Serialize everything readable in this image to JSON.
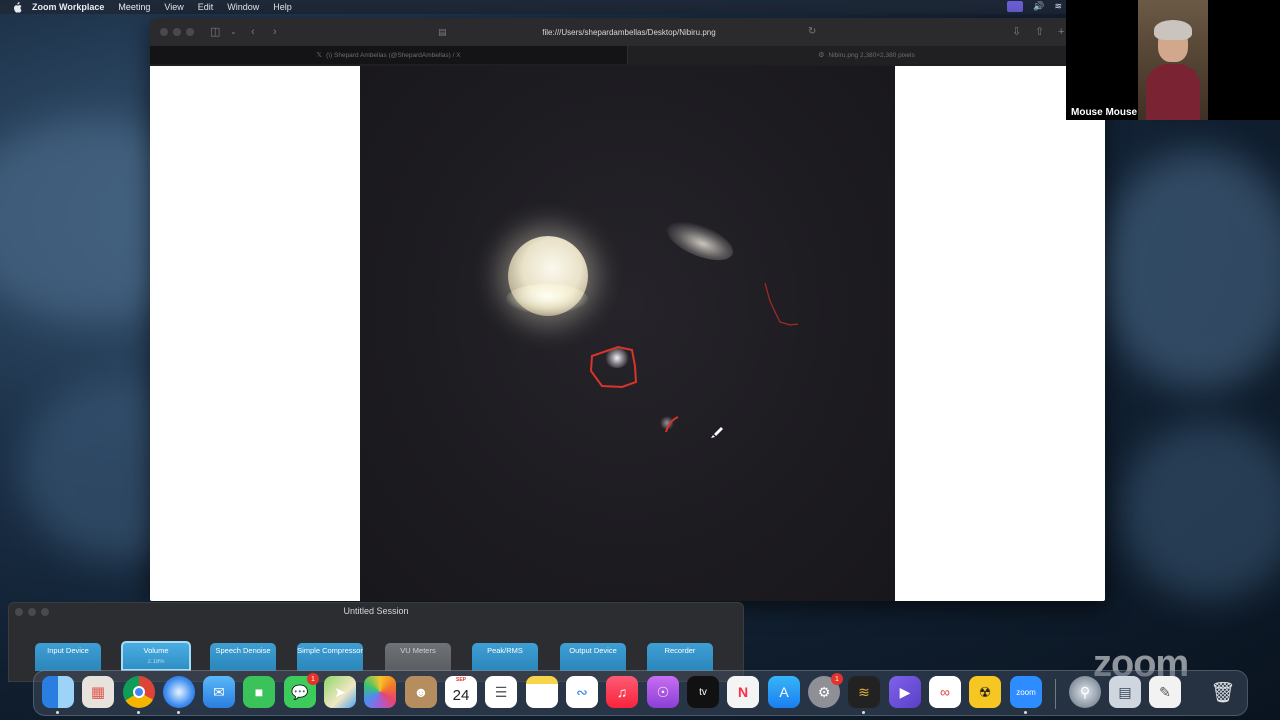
{
  "menubar": {
    "app_name": "Zoom Workplace",
    "menus": [
      "Meeting",
      "View",
      "Edit",
      "Window",
      "Help"
    ]
  },
  "browser": {
    "url": "file:///Users/shepardambellas/Desktop/Nibiru.png",
    "tabs": [
      {
        "label": "(\\) Shepard Ambellas (@ShepardAmbellas) / X",
        "active": true
      },
      {
        "label": "Nibiru.png 2,380×2,380 pixels",
        "active": false
      }
    ]
  },
  "video": {
    "participant_name": "Mouse Mouse"
  },
  "session": {
    "title": "Untitled Session",
    "modules": [
      {
        "label": "Input Device",
        "selected": false,
        "dim": false
      },
      {
        "label": "Volume",
        "sub": "2.18%",
        "selected": true,
        "dim": false
      },
      {
        "label": "Speech Denoise",
        "selected": false,
        "dim": false
      },
      {
        "label": "Simple Compressor",
        "selected": false,
        "dim": false
      },
      {
        "label": "VU Meters",
        "selected": false,
        "dim": true
      },
      {
        "label": "Peak/RMS",
        "selected": false,
        "dim": false
      },
      {
        "label": "Output Device",
        "selected": false,
        "dim": false
      },
      {
        "label": "Recorder",
        "selected": false,
        "dim": false
      }
    ]
  },
  "dock": {
    "calendar_month": "SEP",
    "calendar_day": "24",
    "messages_badge": "1",
    "settings_badge": "1",
    "zoom_label": "zoom"
  },
  "watermark": "zoom",
  "colors": {
    "annotation": "#d9342a",
    "module_blue": "#2b86bb"
  }
}
